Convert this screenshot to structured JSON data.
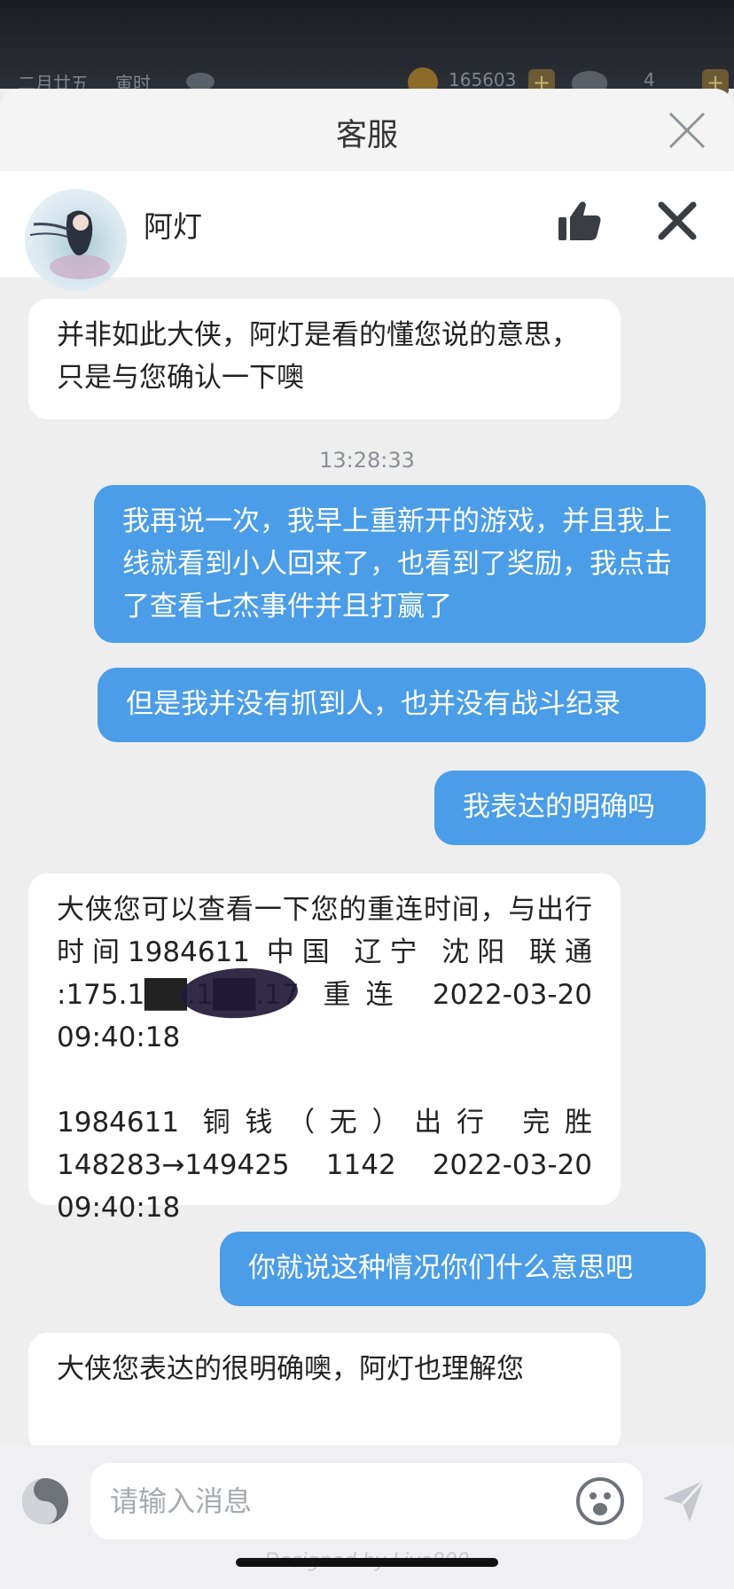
{
  "game_hud": {
    "date": "二月廿五",
    "hour": "寅时",
    "coins": "165603",
    "ingots": "4",
    "plus": "+"
  },
  "sheet": {
    "title": "客服"
  },
  "agent": {
    "name": "阿灯"
  },
  "messages": [
    {
      "from": "agent",
      "text": "并非如此大侠，阿灯是看的懂您说的意思，只是与您确认一下噢"
    },
    {
      "from": "time",
      "text": "13:28:33"
    },
    {
      "from": "user",
      "text": "我再说一次，我早上重新开的游戏，并且我上线就看到小人回来了，也看到了奖励，我点击了查看七杰事件并且打赢了"
    },
    {
      "from": "user",
      "text": "但是我并没有抓到人，也并没有战斗纪录"
    },
    {
      "from": "user",
      "text": "我表达的明确吗"
    },
    {
      "from": "agent",
      "text": "大侠您可以查看一下您的重连时间，与出行时间1984611 中国 辽宁 沈阳 联通 :175.1██.1██.17 重连 2022-03-20 09:40:18\n\n1984611 铜钱（无）出行 完胜 148283→149425 1142 2022-03-20 09:40:18"
    },
    {
      "from": "user",
      "text": "你就说这种情况你们什么意思吧"
    },
    {
      "from": "agent",
      "text": "大侠您表达的很明确噢，阿灯也理解您"
    }
  ],
  "input": {
    "placeholder": "请输入消息"
  },
  "footer": {
    "designed_by": "Designed by Live800"
  },
  "colors": {
    "user_bubble": "#4a9de6",
    "agent_bubble": "#ffffff",
    "background": "#eeeeef"
  },
  "icons": [
    "close-icon",
    "thumbs-up-icon",
    "close-agent-icon",
    "voice-icon",
    "emoji-icon",
    "send-icon",
    "coin-icon",
    "ingot-icon",
    "weather-cloud-icon"
  ]
}
